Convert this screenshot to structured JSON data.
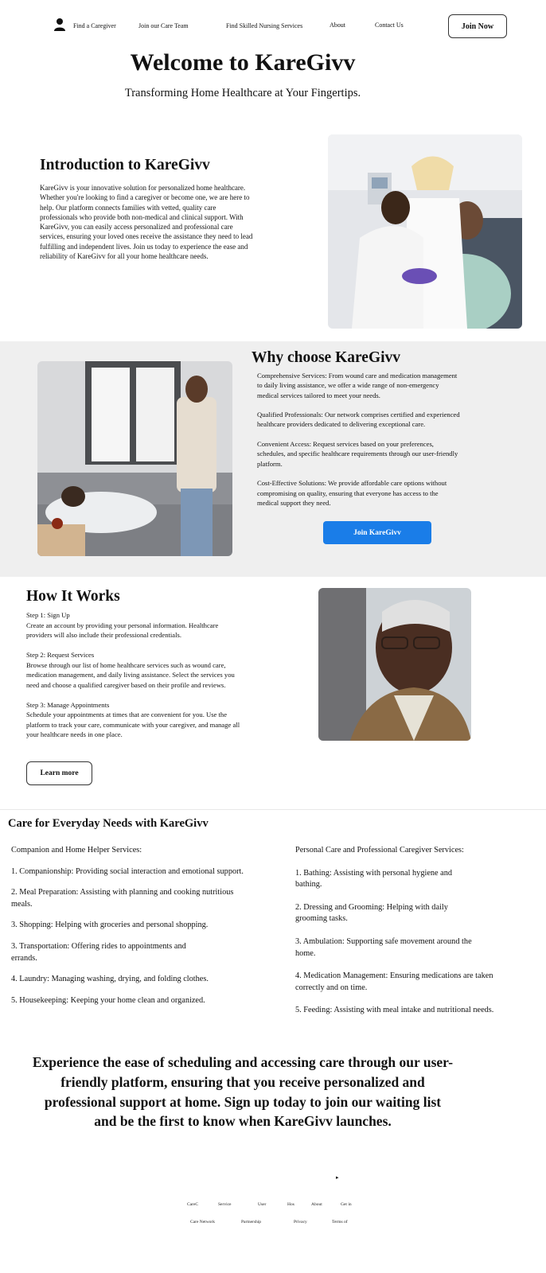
{
  "nav": {
    "links": [
      {
        "label": "Find a Caregiver"
      },
      {
        "label": "Join our Care Team"
      },
      {
        "label": "Find Skilled Nursing Services"
      },
      {
        "label": "About"
      },
      {
        "label": "Contact Us"
      }
    ],
    "join_now": "Join Now",
    "user_icon": "user-icon"
  },
  "hero": {
    "title": "Welcome to KareGivv",
    "subtitle": "Transforming Home Healthcare at Your Fingertips."
  },
  "intro": {
    "title": "Introduction to KareGivv",
    "body": "KareGivv is your innovative solution for personalized home healthcare. Whether you're looking to find a caregiver or become one, we are here to help. Our platform connects families with vetted, quality care professionals who provide both non-medical and clinical support. With KareGivv, you can easily access personalized and professional care services, ensuring your loved ones receive the assistance they need to lead fulfilling and independent lives. Join us today to experience the ease and reliability of KareGivv for all your home healthcare needs."
  },
  "why": {
    "title": "Why choose KareGivv",
    "items": [
      "Comprehensive Services: From wound care and medication management to daily living assistance, we offer a wide range of non-emergency medical services tailored to meet your needs.",
      "Qualified Professionals: Our network comprises certified and experienced healthcare providers dedicated to delivering exceptional care.",
      "Convenient Access: Request services based on your preferences, schedules, and specific healthcare requirements through our user-friendly platform.",
      "Cost-Effective Solutions: We provide affordable care options without compromising on quality, ensuring that everyone has access to the medical support they need."
    ],
    "button": "Join KareGivv"
  },
  "how": {
    "title": "How It Works",
    "steps": [
      {
        "heading": "Step 1: Sign Up",
        "text": "Create an account by providing your personal information. Healthcare providers will also include their professional credentials."
      },
      {
        "heading": "Step 2: Request Services",
        "text": "Browse through our list of home healthcare services such as wound care, medication management, and daily living assistance. Select the services you need and choose a qualified caregiver based on their profile and reviews."
      },
      {
        "heading": "Step 3: Manage Appointments",
        "text": "Schedule your appointments at times that are convenient for you. Use the platform to track your care, communicate with your caregiver, and manage all your healthcare needs in one place."
      }
    ],
    "button": "Learn more"
  },
  "everyday": {
    "title": "Care for Everyday Needs with KareGivv",
    "left": {
      "heading": "Companion and Home Helper Services:",
      "items": [
        "1. Companionship: Providing social interaction and emotional support.",
        "2. Meal Preparation: Assisting with planning and cooking nutritious meals.",
        "3. Shopping: Helping with groceries and personal shopping.",
        "3. Transportation: Offering rides to appointments and errands.",
        "4. Laundry: Managing washing, drying, and folding clothes.",
        "5. Housekeeping: Keeping your home clean and organized."
      ]
    },
    "right": {
      "heading": "Personal Care and Professional Caregiver Services:",
      "items": [
        "1. Bathing: Assisting with personal hygiene and bathing.",
        "2. Dressing and Grooming: Helping with daily grooming tasks.",
        "3. Ambulation: Supporting safe movement around the home.",
        "4. Medication Management: Ensuring medications are taken correctly and on time.",
        "5. Feeding: Assisting with meal intake and nutritional needs."
      ]
    }
  },
  "cta": {
    "text": "Experience the ease of scheduling and accessing care through our user-friendly platform, ensuring that you receive personalized and professional support at home. Sign up today to join our waiting list and be the first to know when KareGivv launches."
  },
  "footer": {
    "arrow": "▸",
    "row1": [
      "CareC",
      "Service",
      "User",
      "Hos",
      "About",
      "Get in"
    ],
    "row2": [
      "Care Network",
      "Partnership",
      "Privacy",
      "Terms of"
    ]
  }
}
